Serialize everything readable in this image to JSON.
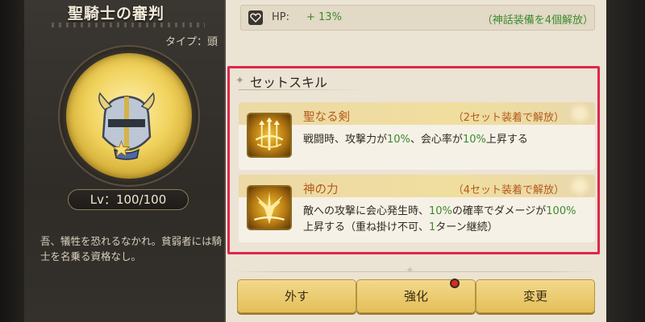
{
  "item": {
    "name": "聖騎士の審判",
    "type": "タイプ：頭",
    "level_label": "Lv",
    "level_value": "：100/100",
    "description": "吾、犠牲を恐れるなかれ。貧弱者には騎士を名乗る資格なし。",
    "icon": "knight-helmet-icon"
  },
  "stat": {
    "icon": "heart-icon",
    "label": "HP:",
    "value": "+ 13%",
    "condition": "（神話装備を4個解放）"
  },
  "set_skill": {
    "header": "セットスキル",
    "skills": [
      {
        "icon": "holy-sword-icon",
        "name": "聖なる剣",
        "condition": "（2セット装着で解放）",
        "desc_parts": [
          "戦闘時、攻撃力が",
          "10%",
          "、会心率が",
          "10%",
          "上昇する"
        ]
      },
      {
        "icon": "divine-power-icon",
        "name": "神の力",
        "condition": "（4セット装着で解放）",
        "desc_parts": [
          "敵への攻撃に会心発生時、",
          "10%",
          "の確率でダメージが",
          "100%",
          "上昇する（重ね掛け不可、",
          "1",
          "ターン継続）"
        ]
      }
    ]
  },
  "buttons": {
    "remove": "外す",
    "enhance": "強化",
    "change": "変更"
  },
  "colors": {
    "highlight_border": "#e0264a",
    "skill_name": "#b35a1a",
    "stat_green": "#3c8a2c",
    "button_gold": "#e3bf5a",
    "notification": "#d62a2a"
  }
}
